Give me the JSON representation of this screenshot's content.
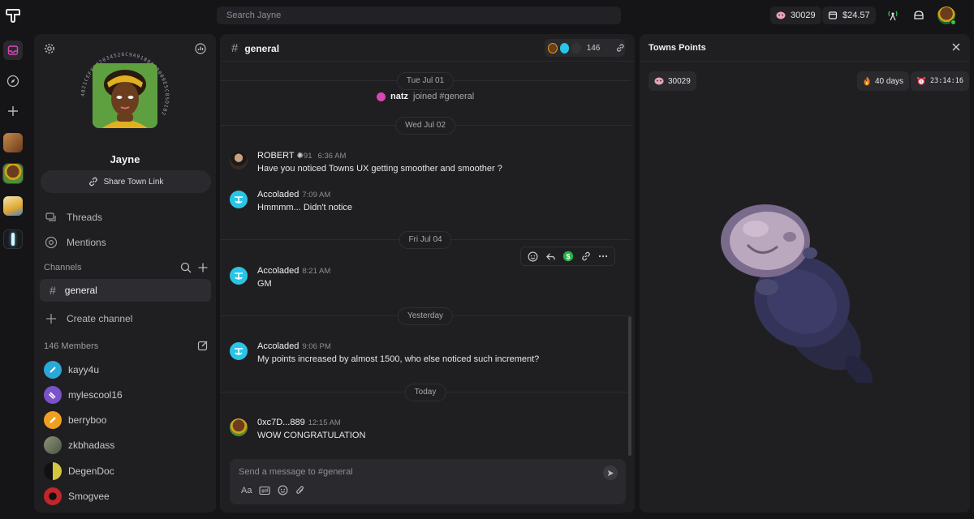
{
  "topbar": {
    "search_placeholder": "Search Jayne",
    "points": "30029",
    "balance": "$24.57"
  },
  "profile": {
    "name": "Jayne",
    "share_label": "Share Town Link",
    "address_ring": "4821CEFF8D7834526C9A9180000000E5C85D1B2"
  },
  "nav": {
    "threads": "Threads",
    "mentions": "Mentions",
    "channels_heading": "Channels",
    "active_channel": "general",
    "create_channel": "Create channel",
    "members_heading": "146 Members"
  },
  "members": [
    {
      "name": "kayy4u",
      "color": "#2aa8d8"
    },
    {
      "name": "mylescool16",
      "color": "#7b52c9"
    },
    {
      "name": "berryboo",
      "color": "#f0a020"
    },
    {
      "name": "zkbhadass",
      "color": "#6f7a60"
    },
    {
      "name": "DegenDoc",
      "color": "#d4c640"
    },
    {
      "name": "Smogvee",
      "color": "#c0262b"
    }
  ],
  "chat": {
    "channel": "general",
    "member_count": "146",
    "dates": {
      "d1": "Tue Jul 01",
      "d2": "Wed Jul 02",
      "d3": "Fri Jul 04",
      "d4": "Yesterday",
      "d5": "Today"
    },
    "join_event": {
      "user": "natz",
      "text": "joined #general"
    },
    "messages": [
      {
        "author": "ROBERT",
        "badge": "91",
        "time": "6:36 AM",
        "text": "Have you noticed Towns UX getting smoother and smoother ?"
      },
      {
        "author": "Accoladed",
        "time": "7:09 AM",
        "text": "Hmmmm... Didn't notice"
      },
      {
        "author": "Accoladed",
        "time": "8:21 AM",
        "text": "GM"
      },
      {
        "author": "Accoladed",
        "time": "9:06 PM",
        "text": "My points increased by almost 1500, who else noticed such increment?"
      },
      {
        "author": "0xc7D...889",
        "time": "12:15 AM",
        "text": "WOW CONGRATULATION"
      }
    ],
    "composer_placeholder": "Send a message to #general",
    "format_label": "Aa"
  },
  "panel": {
    "title": "Towns Points",
    "points": "30029",
    "streak": "40 days",
    "timer": "23:14:16"
  },
  "colors": {
    "accent_cyan": "#29c5e8",
    "app_bg": "#151517",
    "panel_bg": "#1f1f22"
  }
}
